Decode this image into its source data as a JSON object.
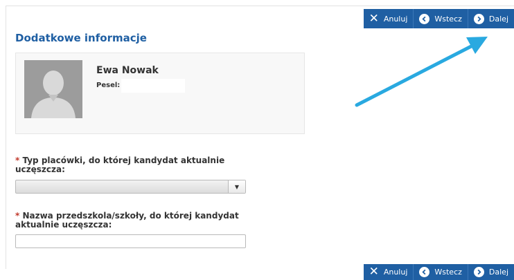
{
  "toolbar": {
    "cancel_label": "Anuluj",
    "back_label": "Wstecz",
    "next_label": "Dalej"
  },
  "page": {
    "title": "Dodatkowe informacje"
  },
  "candidate": {
    "name": "Ewa Nowak",
    "pesel_label": "Pesel:",
    "pesel_value": ""
  },
  "form": {
    "required_mark": "*",
    "facility_type_label": "Typ placówki, do której kandydat aktualnie uczęszcza:",
    "facility_type_value": "",
    "school_name_label": "Nazwa przedszkola/szkoły, do której kandydat aktualnie uczęszcza:",
    "school_name_value": ""
  },
  "colors": {
    "accent": "#1f5fa3",
    "annotation_arrow": "#29a9e0",
    "required": "#c0392b"
  },
  "icons": {
    "cancel": "x-icon",
    "back": "chevron-left-circle-icon",
    "next": "chevron-right-circle-icon",
    "dropdown": "caret-down-icon"
  }
}
